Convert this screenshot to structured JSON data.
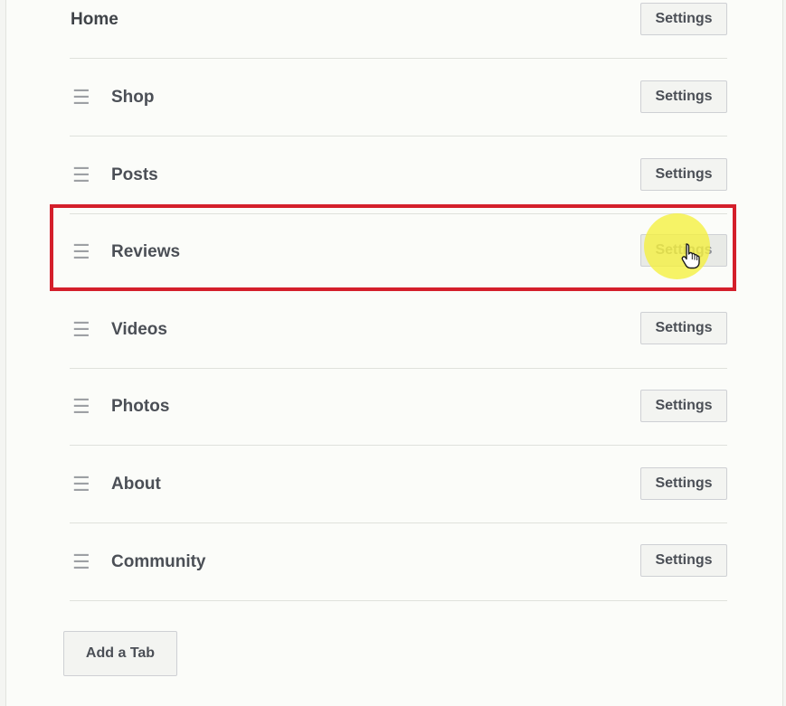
{
  "tabs": [
    {
      "label": "Home",
      "settings_label": "Settings",
      "draggable": false
    },
    {
      "label": "Shop",
      "settings_label": "Settings",
      "draggable": true
    },
    {
      "label": "Posts",
      "settings_label": "Settings",
      "draggable": true
    },
    {
      "label": "Reviews",
      "settings_label": "Settings",
      "draggable": true
    },
    {
      "label": "Videos",
      "settings_label": "Settings",
      "draggable": true
    },
    {
      "label": "Photos",
      "settings_label": "Settings",
      "draggable": true
    },
    {
      "label": "About",
      "settings_label": "Settings",
      "draggable": true
    },
    {
      "label": "Community",
      "settings_label": "Settings",
      "draggable": true
    }
  ],
  "highlighted_tab": "Reviews",
  "drag_handle_icon": "drag-handle-icon",
  "add_tab_label": "Add a Tab",
  "colors": {
    "highlight": "#d41f2b",
    "cursor_glow": "#f5f03c",
    "label_text": "#4b4f56"
  }
}
